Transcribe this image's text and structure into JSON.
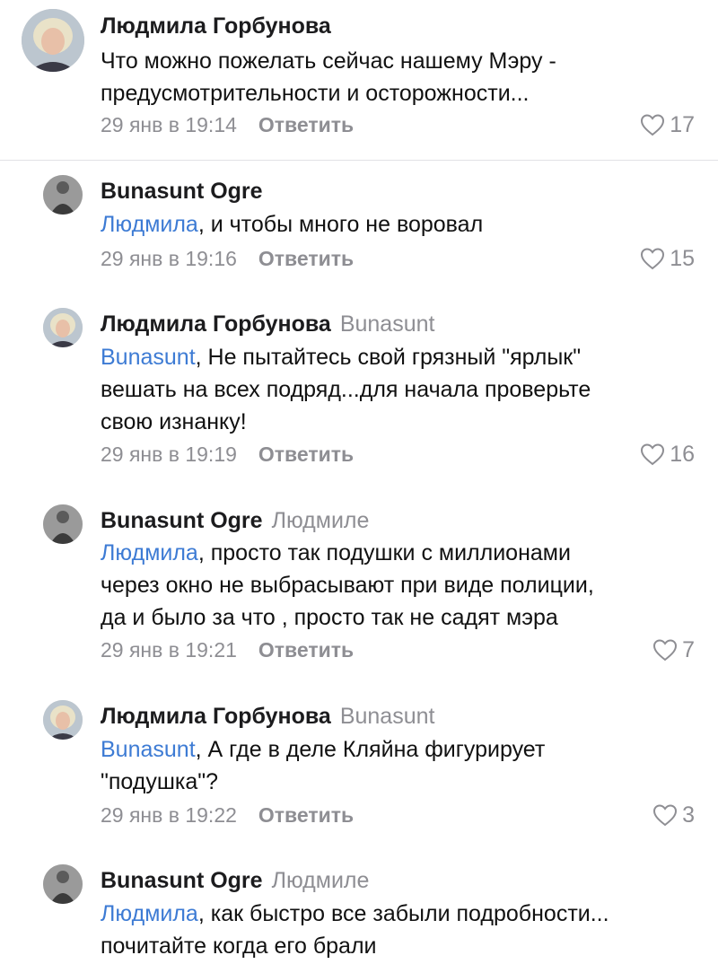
{
  "comments": [
    {
      "author": "Людмила Горбунова",
      "reply_to": "",
      "mention": "",
      "text": "Что можно пожелать сейчас нашему Мэру -\nпредусмотрительности и осторожности...",
      "date": "29 янв в 19:14",
      "reply_label": "Ответить",
      "likes": "17"
    },
    {
      "author": "Bunasunt Ogre",
      "reply_to": "",
      "mention": "Людмила",
      "text": ", и чтобы много не воровал",
      "date": "29 янв в 19:16",
      "reply_label": "Ответить",
      "likes": "15"
    },
    {
      "author": "Людмила Горбунова",
      "reply_to": "Bunasunt",
      "mention": "Bunasunt",
      "text": ", Не пытайтесь свой грязный \"ярлык\"\nвешать на всех подряд...для начала проверьте\nсвою изнанку!",
      "date": "29 янв в 19:19",
      "reply_label": "Ответить",
      "likes": "16"
    },
    {
      "author": "Bunasunt Ogre",
      "reply_to": "Людмиле",
      "mention": "Людмила",
      "text": ", просто так подушки с миллионами\nчерез окно не выбрасывают при виде полиции,\nда и было за что , просто так не садят мэра",
      "date": "29 янв в 19:21",
      "reply_label": "Ответить",
      "likes": "7"
    },
    {
      "author": "Людмила Горбунова",
      "reply_to": "Bunasunt",
      "mention": "Bunasunt",
      "text": ", А где в деле Кляйна фигурирует\n\"подушка\"?",
      "date": "29 янв в 19:22",
      "reply_label": "Ответить",
      "likes": "3"
    },
    {
      "author": "Bunasunt Ogre",
      "reply_to": "Людмиле",
      "mention": "Людмила",
      "text": ", как быстро все забыли подробности...\nпочитайте когда его брали",
      "date": "",
      "reply_label": "",
      "likes": ""
    }
  ],
  "colors": {
    "mention": "#3d7bd4",
    "meta": "#8e8e93",
    "divider": "#e2e2e6"
  },
  "icons": {
    "like": "heart-outline-icon"
  }
}
